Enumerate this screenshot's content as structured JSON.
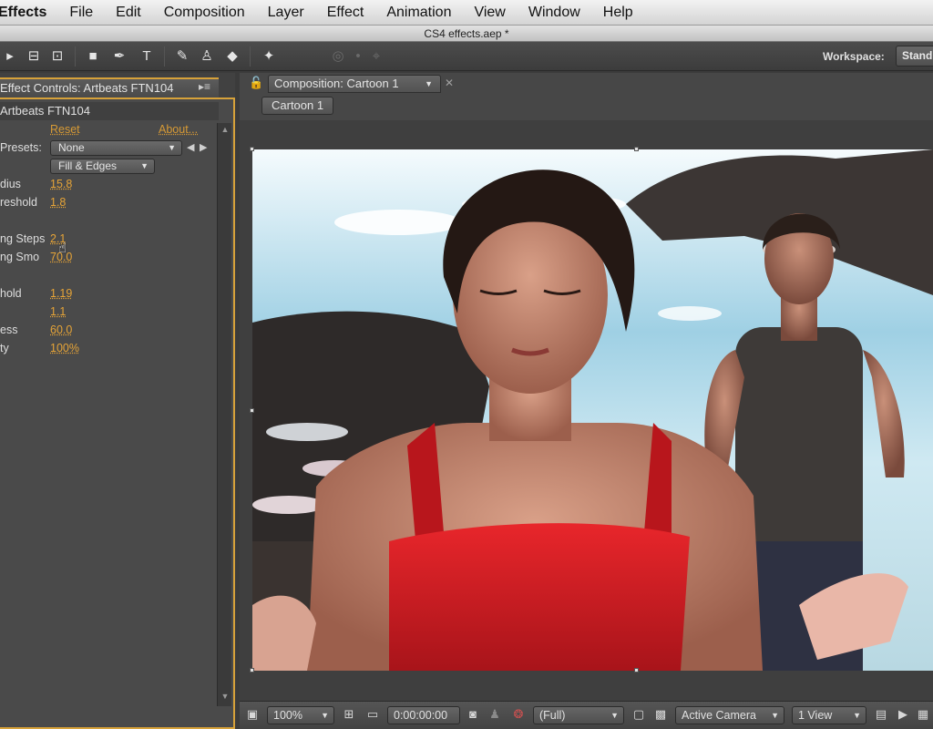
{
  "menubar": {
    "app": "Effects",
    "items": [
      "File",
      "Edit",
      "Composition",
      "Layer",
      "Effect",
      "Animation",
      "View",
      "Window",
      "Help"
    ]
  },
  "titlebar": {
    "title": "CS4 effects.aep *"
  },
  "toolbar": {
    "workspace_label": "Workspace:",
    "workspace_value": "Stand"
  },
  "effect_controls": {
    "tab_label": "Effect Controls: Artbeats FTN104",
    "layer_name": "Artbeats FTN104",
    "reset_link": "Reset",
    "about_link": "About...",
    "presets_label": "Presets:",
    "presets_value": "None",
    "render_value": "Fill & Edges",
    "rows": [
      {
        "label": "dius",
        "value": "15.8"
      },
      {
        "label": "reshold",
        "value": "1.8"
      },
      {
        "label": "ng Steps",
        "value": "2.1"
      },
      {
        "label": "ng Smo",
        "value": "70.0"
      },
      {
        "label": "hold",
        "value": "1.19"
      },
      {
        "label": "",
        "value": "1.1"
      },
      {
        "label": "ess",
        "value": "60.0"
      },
      {
        "label": "ty",
        "value": "100%"
      }
    ]
  },
  "composition": {
    "tab_label": "Composition: Cartoon 1",
    "breadcrumb": "Cartoon 1"
  },
  "viewer_bar": {
    "zoom": "100%",
    "timecode": "0:00:00:00",
    "resolution": "(Full)",
    "camera": "Active Camera",
    "views": "1 View"
  },
  "colors": {
    "accent_orange": "#d7a23a",
    "value_orange": "#e6a437",
    "panel_bg": "#4a4a4a",
    "top_red": "#d8242a"
  },
  "icons": {
    "lock": "lock-icon",
    "panel_menu": "panel-menu-icon",
    "close": "close-icon"
  }
}
